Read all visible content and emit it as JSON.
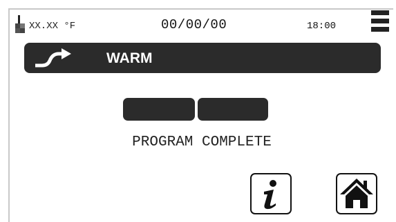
{
  "status_bar": {
    "temperature": "XX.XX °F",
    "date": "00/00/00",
    "time": "18:00",
    "icons": [
      "thermometer-icon",
      "menu-icon"
    ]
  },
  "title_bar": {
    "icon": "ramp-arrow-icon",
    "title": "WARM"
  },
  "progress": {
    "segments_filled": 2,
    "segments_total": 2
  },
  "status_text": "PROGRAM COMPLETE",
  "buttons": {
    "info": "info-icon",
    "home": "home-icon"
  },
  "colors": {
    "dark": "#2b2b2b",
    "background": "#ffffff"
  }
}
